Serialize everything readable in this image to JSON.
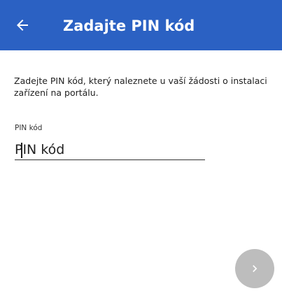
{
  "app_bar": {
    "title": "Zadajte PIN kód",
    "back_icon": "arrow-back-icon",
    "background_color": "#2b61c3"
  },
  "form": {
    "instructions": "Zadejte PIN kód, který naleznete u vaší žádosti o instalaci zařízení na portálu.",
    "pin_field": {
      "label": "PIN kód",
      "placeholder": "PIN kód",
      "value": ""
    }
  },
  "next_button": {
    "icon": "chevron-right-icon",
    "color": "#bdbdbd",
    "enabled": false
  }
}
